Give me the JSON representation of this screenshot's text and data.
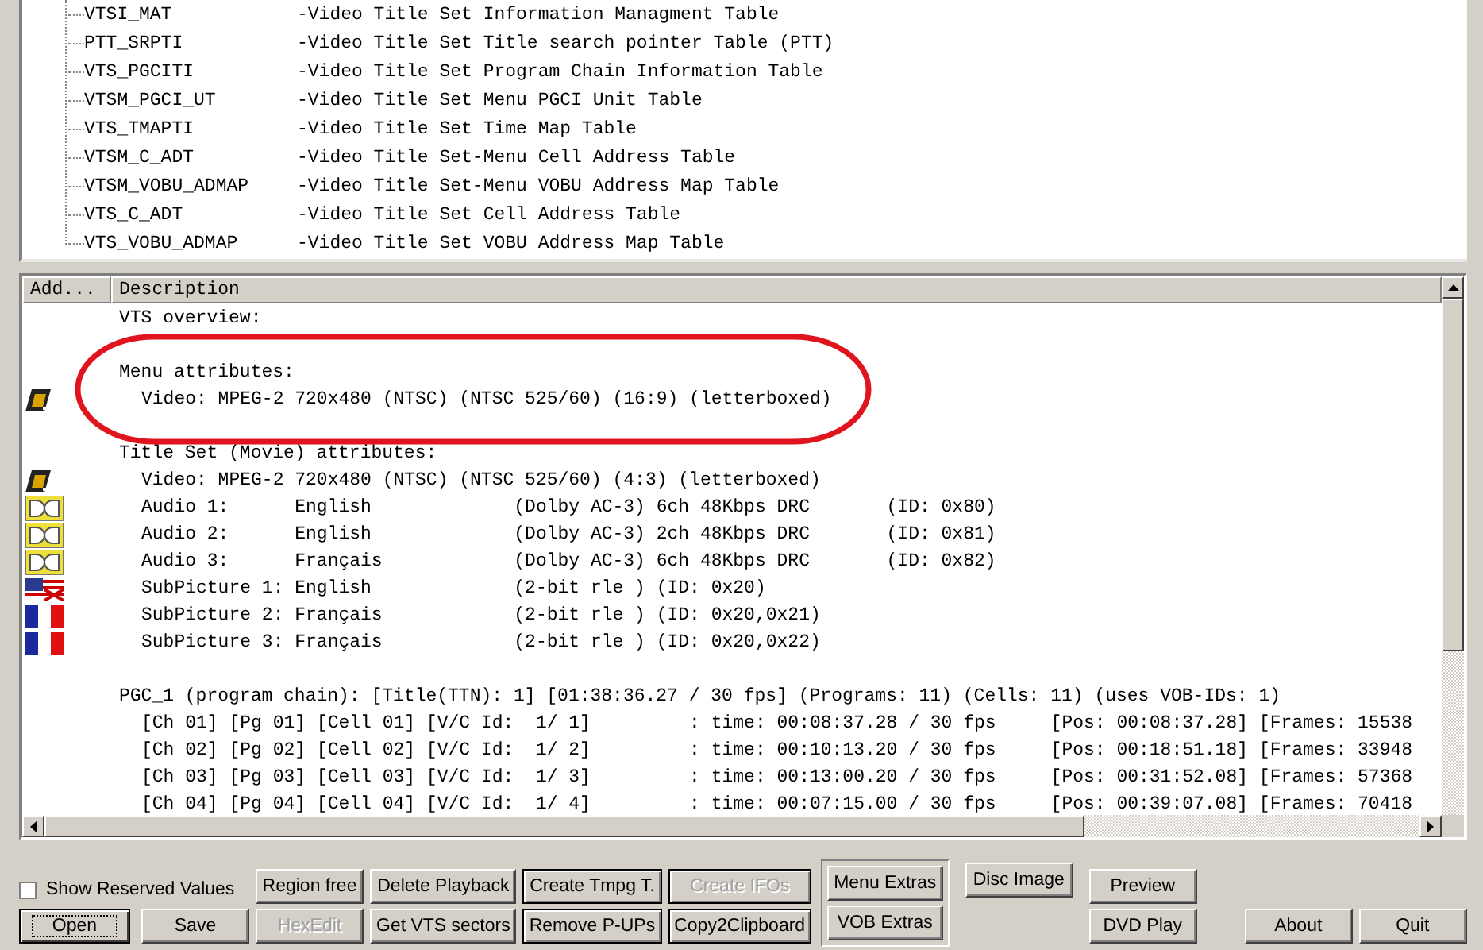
{
  "tree": {
    "items": [
      {
        "name": "VTSI_MAT",
        "description": "-Video Title Set Information Managment Table"
      },
      {
        "name": "PTT_SRPTI",
        "description": "-Video Title Set Title search pointer Table (PTT)"
      },
      {
        "name": "VTS_PGCITI",
        "description": "-Video Title Set Program Chain Information Table"
      },
      {
        "name": "VTSM_PGCI_UT",
        "description": "-Video Title Set Menu PGCI Unit Table"
      },
      {
        "name": "VTS_TMAPTI",
        "description": "-Video Title Set Time Map Table"
      },
      {
        "name": "VTSM_C_ADT",
        "description": "-Video Title Set-Menu Cell Address Table"
      },
      {
        "name": "VTSM_VOBU_ADMAP",
        "description": "-Video Title Set-Menu VOBU Address Map Table"
      },
      {
        "name": "VTS_C_ADT",
        "description": "-Video Title Set Cell Address Table"
      },
      {
        "name": "VTS_VOBU_ADMAP",
        "description": "-Video Title Set VOBU Address Map Table"
      }
    ]
  },
  "details": {
    "columns": [
      "Add...",
      "Description"
    ],
    "rows": [
      {
        "kind": "heading",
        "text": "VTS overview:"
      },
      {
        "kind": "blank"
      },
      {
        "kind": "heading",
        "text": "Menu attributes:"
      },
      {
        "kind": "video",
        "text": "Video: MPEG-2 720x480 (NTSC) (NTSC 525/60) (16:9) (letterboxed)"
      },
      {
        "kind": "blank"
      },
      {
        "kind": "heading",
        "text": "Title Set (Movie) attributes:"
      },
      {
        "kind": "video",
        "text": "Video: MPEG-2 720x480 (NTSC) (NTSC 525/60) (4:3) (letterboxed)"
      },
      {
        "kind": "audio",
        "text": "Audio 1:      English             (Dolby AC-3) 6ch 48Kbps DRC       (ID: 0x80)"
      },
      {
        "kind": "audio",
        "text": "Audio 2:      English             (Dolby AC-3) 2ch 48Kbps DRC       (ID: 0x81)"
      },
      {
        "kind": "audio",
        "text": "Audio 3:      Français            (Dolby AC-3) 6ch 48Kbps DRC       (ID: 0x82)"
      },
      {
        "kind": "subtitle_en",
        "text": "SubPicture 1: English             (2-bit rle ) (ID: 0x20)"
      },
      {
        "kind": "subtitle_fr",
        "text": "SubPicture 2: Français            (2-bit rle ) (ID: 0x20,0x21)"
      },
      {
        "kind": "subtitle_fr",
        "text": "SubPicture 3: Français            (2-bit rle ) (ID: 0x20,0x22)"
      },
      {
        "kind": "blank"
      },
      {
        "kind": "heading",
        "text": "PGC_1 (program chain): [Title(TTN): 1] [01:38:36.27 / 30 fps] (Programs: 11) (Cells: 11) (uses VOB-IDs: 1)"
      },
      {
        "kind": "chapter",
        "text": "[Ch 01] [Pg 01] [Cell 01] [V/C Id:  1/ 1]         : time: 00:08:37.28 / 30 fps     [Pos: 00:08:37.28] [Frames: 15538"
      },
      {
        "kind": "chapter",
        "text": "[Ch 02] [Pg 02] [Cell 02] [V/C Id:  1/ 2]         : time: 00:10:13.20 / 30 fps     [Pos: 00:18:51.18] [Frames: 33948"
      },
      {
        "kind": "chapter",
        "text": "[Ch 03] [Pg 03] [Cell 03] [V/C Id:  1/ 3]         : time: 00:13:00.20 / 30 fps     [Pos: 00:31:52.08] [Frames: 57368"
      },
      {
        "kind": "chapter",
        "text": "[Ch 04] [Pg 04] [Cell 04] [V/C Id:  1/ 4]         : time: 00:07:15.00 / 30 fps     [Pos: 00:39:07.08] [Frames: 70418"
      }
    ]
  },
  "options": {
    "show_reserved_values": {
      "label": "Show Reserved Values",
      "checked": false
    }
  },
  "button_columns": [
    {
      "kind": "plain",
      "buttons": [
        {
          "label": "Open",
          "disabled": false,
          "focused": true
        }
      ]
    },
    {
      "kind": "plain",
      "buttons": [
        {
          "label": "Save",
          "disabled": false,
          "focused": false
        }
      ]
    },
    {
      "kind": "plain",
      "buttons": [
        {
          "label": "Region free",
          "disabled": false,
          "focused": false
        },
        {
          "label": "HexEdit",
          "disabled": true,
          "focused": false
        }
      ]
    },
    {
      "kind": "plain",
      "buttons": [
        {
          "label": "Delete Playback",
          "disabled": false,
          "focused": false
        },
        {
          "label": "Get VTS sectors",
          "disabled": false,
          "focused": false
        }
      ]
    },
    {
      "kind": "framed",
      "buttons": [
        {
          "label": "Create Tmpg T.",
          "disabled": false,
          "focused": false
        },
        {
          "label": "Remove P-UPs",
          "disabled": false,
          "focused": false
        }
      ]
    },
    {
      "kind": "framed",
      "buttons": [
        {
          "label": "Create IFOs",
          "disabled": true,
          "focused": false
        },
        {
          "label": "Copy2Clipboard",
          "disabled": false,
          "focused": false
        }
      ]
    },
    {
      "kind": "group",
      "buttons": [
        {
          "label": "Menu Extras",
          "disabled": false,
          "focused": false
        },
        {
          "label": "VOB Extras",
          "disabled": false,
          "focused": false
        }
      ]
    },
    {
      "kind": "top",
      "buttons": [
        {
          "label": "Disc Image",
          "disabled": false,
          "focused": false
        }
      ]
    },
    {
      "kind": "plain",
      "buttons": [
        {
          "label": "Preview",
          "disabled": false,
          "focused": false
        },
        {
          "label": "DVD Play",
          "disabled": false,
          "focused": false
        }
      ]
    },
    {
      "kind": "bottom",
      "buttons": [
        {
          "label": "About",
          "disabled": false,
          "focused": false
        }
      ]
    },
    {
      "kind": "bottom",
      "buttons": [
        {
          "label": "Quit",
          "disabled": false,
          "focused": false
        }
      ]
    }
  ]
}
